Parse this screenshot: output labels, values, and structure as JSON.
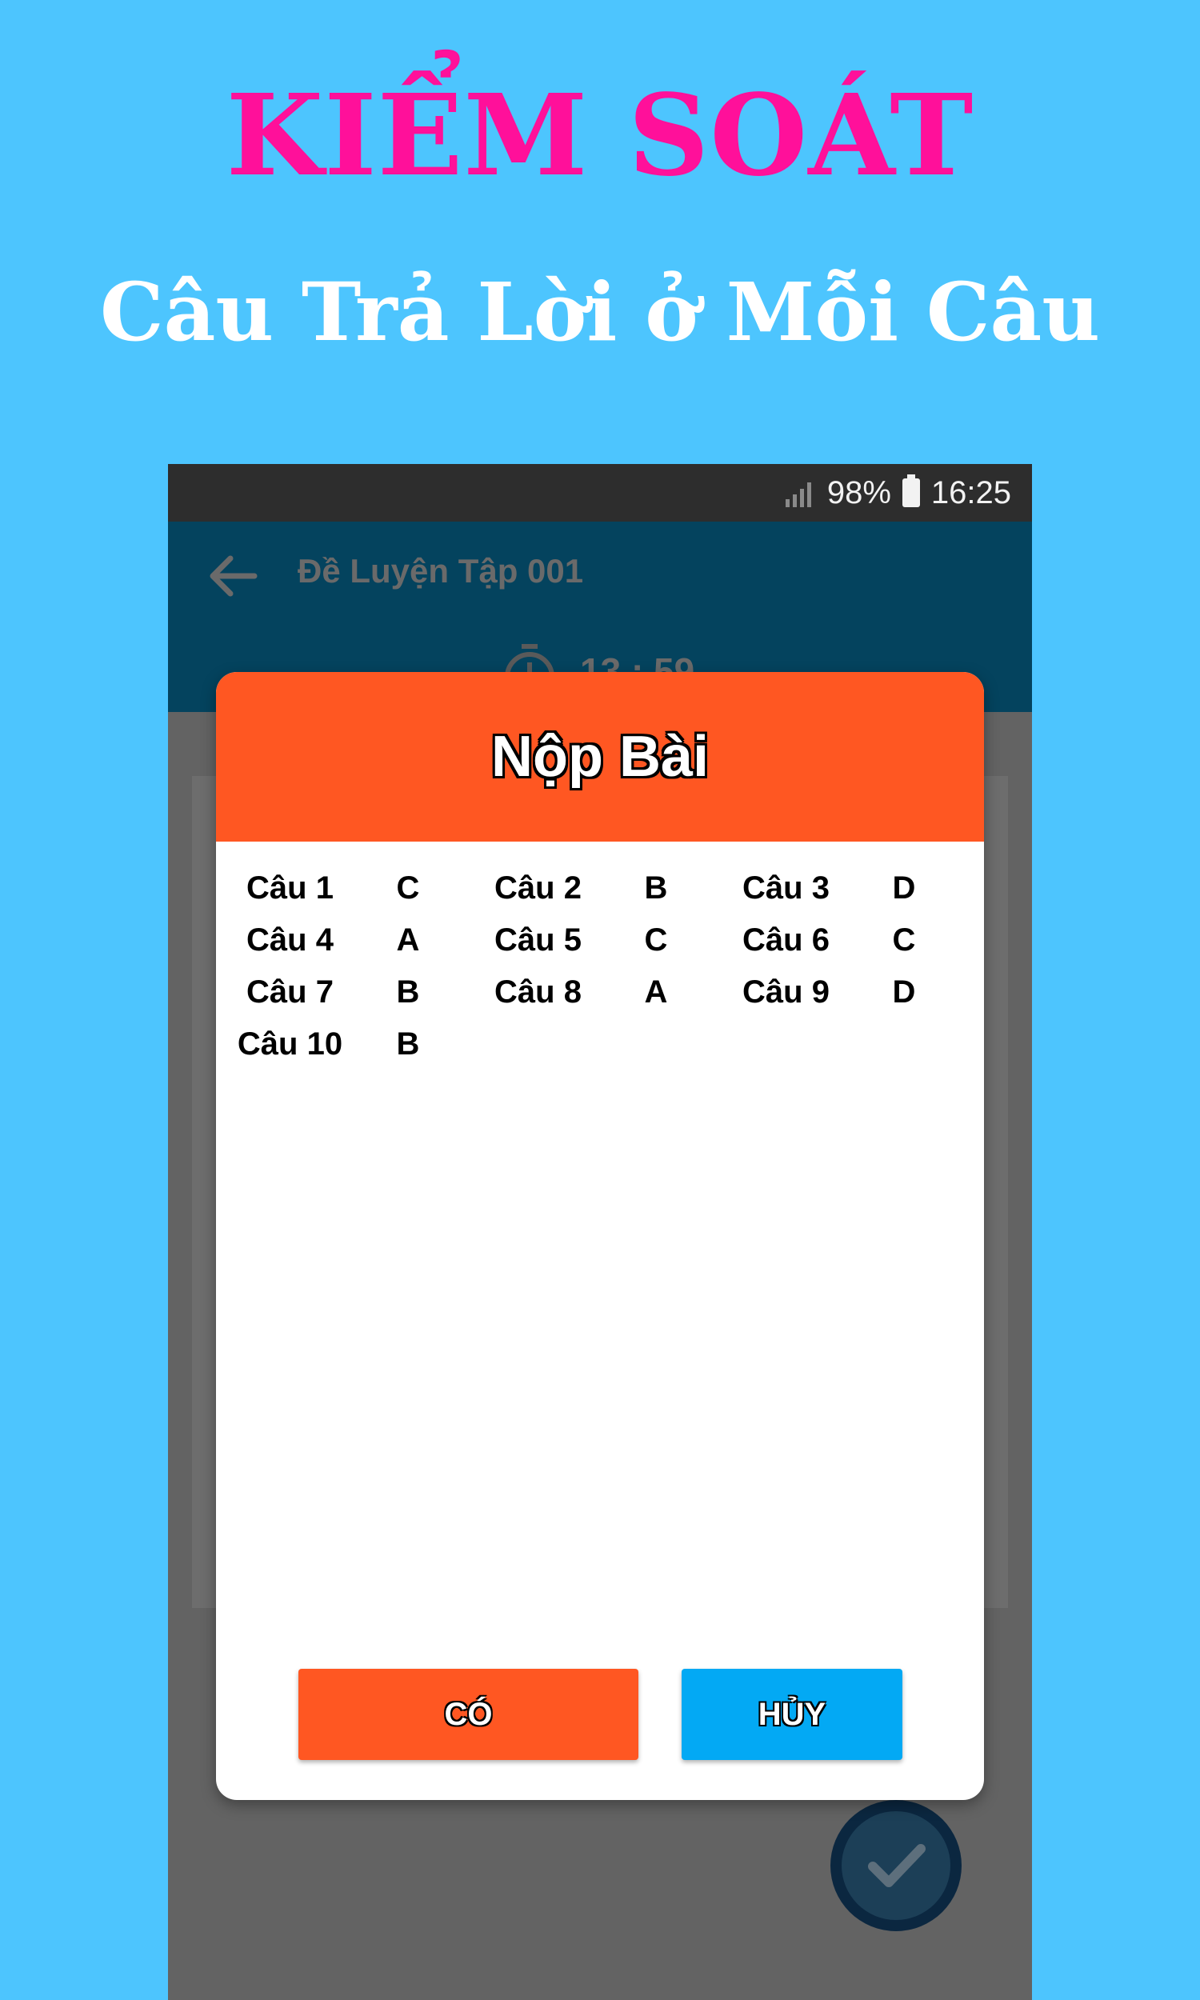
{
  "promo": {
    "title": "KIỂM SOÁT",
    "subtitle": "Câu Trả Lời ở Mỗi Câu"
  },
  "status_bar": {
    "battery": "98%",
    "time": "16:25"
  },
  "app_bar": {
    "title": "Đề Luyện Tập 001",
    "timer": "13 : 59"
  },
  "dialog": {
    "title": "Nộp Bài",
    "answers": [
      {
        "label": "Câu 1",
        "answer": "C"
      },
      {
        "label": "Câu 2",
        "answer": "B"
      },
      {
        "label": "Câu 3",
        "answer": "D"
      },
      {
        "label": "Câu 4",
        "answer": "A"
      },
      {
        "label": "Câu 5",
        "answer": "C"
      },
      {
        "label": "Câu 6",
        "answer": "C"
      },
      {
        "label": "Câu 7",
        "answer": "B"
      },
      {
        "label": "Câu 8",
        "answer": "A"
      },
      {
        "label": "Câu 9",
        "answer": "D"
      },
      {
        "label": "Câu 10",
        "answer": "B"
      }
    ],
    "yes_label": "CÓ",
    "cancel_label": "HỦY"
  },
  "colors": {
    "background": "#4dc5fe",
    "title_pink": "#ff109a",
    "dialog_accent": "#ff5722",
    "cancel_blue": "#03a9f4",
    "app_bar": "#04435e"
  },
  "icons": [
    "signal-icon",
    "battery-icon",
    "back-arrow-icon",
    "timer-icon",
    "check-icon"
  ]
}
